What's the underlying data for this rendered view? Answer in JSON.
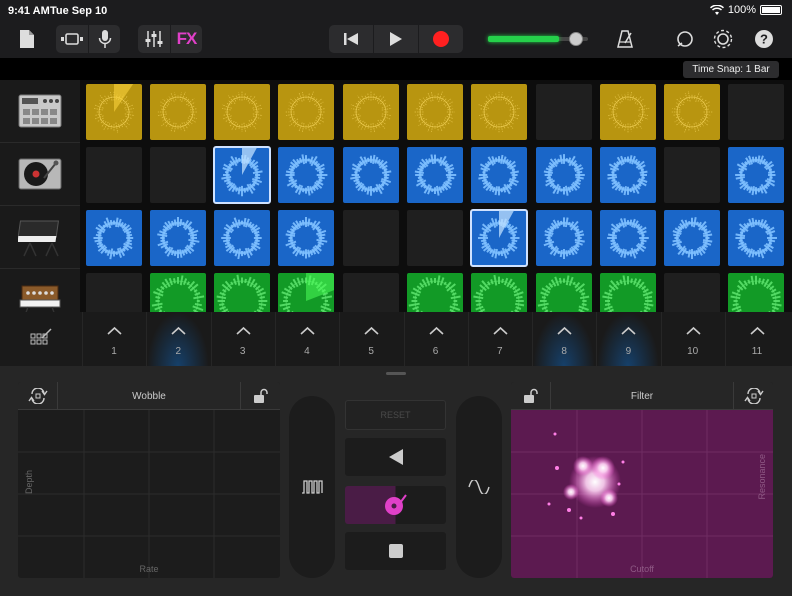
{
  "status": {
    "time": "9:41 AM",
    "date": "Tue Sep 10",
    "battery": "100%"
  },
  "toolbar": {
    "icons": [
      "document-icon",
      "view-toggle-icon",
      "microphone-icon",
      "mixer-icon",
      "rewind-icon",
      "play-icon",
      "record-icon",
      "metronome-icon",
      "loop-icon",
      "settings-icon",
      "help-icon"
    ],
    "fx_label": "FX",
    "record_color": "#ff2020",
    "volume_level": 0.82
  },
  "time_snap": "Time Snap: 1 Bar",
  "tracks": [
    {
      "instrument": "drum-machine-icon",
      "color": "yellow"
    },
    {
      "instrument": "turntable-icon",
      "color": "blue"
    },
    {
      "instrument": "synth-keyboard-icon",
      "color": "blue"
    },
    {
      "instrument": "analog-synth-icon",
      "color": "green"
    }
  ],
  "grid_rows": [
    [
      "y-playing",
      "y",
      "y",
      "y",
      "y",
      "y",
      "y",
      "empty",
      "y",
      "y",
      "empty"
    ],
    [
      "empty",
      "empty",
      "b-playing-sel",
      "b",
      "b",
      "b",
      "b",
      "b",
      "b",
      "empty",
      "b"
    ],
    [
      "b",
      "b",
      "b",
      "b",
      "empty",
      "empty",
      "b-playing-sel",
      "b",
      "b",
      "b",
      "b"
    ],
    [
      "empty",
      "g",
      "g",
      "g-playing",
      "empty",
      "g",
      "g",
      "g",
      "g",
      "empty",
      "g"
    ]
  ],
  "colors": {
    "yellow": "#b89510",
    "blue": "#1a66c8",
    "green": "#129a26",
    "fx_pink": "#e040c8",
    "filter_pad": "#5c1a50"
  },
  "triggers": [
    {
      "num": "1"
    },
    {
      "num": "2"
    },
    {
      "num": "3"
    },
    {
      "num": "4"
    },
    {
      "num": "5"
    },
    {
      "num": "6"
    },
    {
      "num": "7"
    },
    {
      "num": "8"
    },
    {
      "num": "9"
    },
    {
      "num": "10"
    },
    {
      "num": "11"
    }
  ],
  "fx": {
    "left_pad": {
      "title": "Wobble",
      "x_axis": "Rate",
      "y_axis": "Depth"
    },
    "right_pad": {
      "title": "Filter",
      "x_axis": "Cutoff",
      "y_axis": "Resonance"
    },
    "reset_label": "RESET",
    "left_pill_icon": "gate-icon",
    "right_pill_icon": "wave-icon"
  }
}
